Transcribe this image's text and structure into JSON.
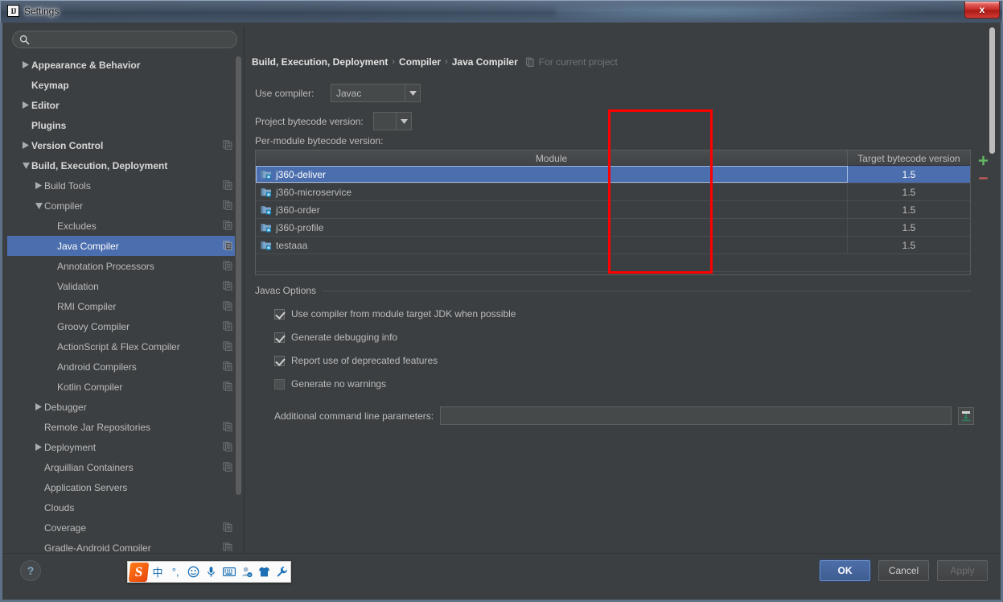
{
  "window": {
    "title": "Settings",
    "logo_text": "IJ",
    "close_label": "x"
  },
  "sidebar": {
    "search": {
      "value": "",
      "placeholder": ""
    },
    "items": [
      {
        "label": "Appearance & Behavior",
        "indent": 0,
        "arrow": "collapsed",
        "bold": true,
        "cfg": false,
        "selected": false
      },
      {
        "label": "Keymap",
        "indent": 0,
        "arrow": "none",
        "bold": true,
        "cfg": false,
        "selected": false
      },
      {
        "label": "Editor",
        "indent": 0,
        "arrow": "collapsed",
        "bold": true,
        "cfg": false,
        "selected": false
      },
      {
        "label": "Plugins",
        "indent": 0,
        "arrow": "none",
        "bold": true,
        "cfg": false,
        "selected": false
      },
      {
        "label": "Version Control",
        "indent": 0,
        "arrow": "collapsed",
        "bold": true,
        "cfg": true,
        "selected": false
      },
      {
        "label": "Build, Execution, Deployment",
        "indent": 0,
        "arrow": "expanded",
        "bold": true,
        "cfg": false,
        "selected": false
      },
      {
        "label": "Build Tools",
        "indent": 1,
        "arrow": "collapsed",
        "bold": false,
        "cfg": true,
        "selected": false
      },
      {
        "label": "Compiler",
        "indent": 1,
        "arrow": "expanded",
        "bold": false,
        "cfg": true,
        "selected": false
      },
      {
        "label": "Excludes",
        "indent": 2,
        "arrow": "none",
        "bold": false,
        "cfg": true,
        "selected": false
      },
      {
        "label": "Java Compiler",
        "indent": 2,
        "arrow": "none",
        "bold": false,
        "cfg": true,
        "selected": true
      },
      {
        "label": "Annotation Processors",
        "indent": 2,
        "arrow": "none",
        "bold": false,
        "cfg": true,
        "selected": false
      },
      {
        "label": "Validation",
        "indent": 2,
        "arrow": "none",
        "bold": false,
        "cfg": true,
        "selected": false
      },
      {
        "label": "RMI Compiler",
        "indent": 2,
        "arrow": "none",
        "bold": false,
        "cfg": true,
        "selected": false
      },
      {
        "label": "Groovy Compiler",
        "indent": 2,
        "arrow": "none",
        "bold": false,
        "cfg": true,
        "selected": false
      },
      {
        "label": "ActionScript & Flex Compiler",
        "indent": 2,
        "arrow": "none",
        "bold": false,
        "cfg": true,
        "selected": false
      },
      {
        "label": "Android Compilers",
        "indent": 2,
        "arrow": "none",
        "bold": false,
        "cfg": true,
        "selected": false
      },
      {
        "label": "Kotlin Compiler",
        "indent": 2,
        "arrow": "none",
        "bold": false,
        "cfg": true,
        "selected": false
      },
      {
        "label": "Debugger",
        "indent": 1,
        "arrow": "collapsed",
        "bold": false,
        "cfg": false,
        "selected": false
      },
      {
        "label": "Remote Jar Repositories",
        "indent": 1,
        "arrow": "none",
        "bold": false,
        "cfg": true,
        "selected": false
      },
      {
        "label": "Deployment",
        "indent": 1,
        "arrow": "collapsed",
        "bold": false,
        "cfg": true,
        "selected": false
      },
      {
        "label": "Arquillian Containers",
        "indent": 1,
        "arrow": "none",
        "bold": false,
        "cfg": true,
        "selected": false
      },
      {
        "label": "Application Servers",
        "indent": 1,
        "arrow": "none",
        "bold": false,
        "cfg": false,
        "selected": false
      },
      {
        "label": "Clouds",
        "indent": 1,
        "arrow": "none",
        "bold": false,
        "cfg": false,
        "selected": false
      },
      {
        "label": "Coverage",
        "indent": 1,
        "arrow": "none",
        "bold": false,
        "cfg": true,
        "selected": false
      },
      {
        "label": "Gradle-Android Compiler",
        "indent": 1,
        "arrow": "none",
        "bold": false,
        "cfg": true,
        "selected": false
      }
    ]
  },
  "panel": {
    "breadcrumb": {
      "seg1": "Build, Execution, Deployment",
      "sep1": "›",
      "seg2": "Compiler",
      "sep2": "›",
      "seg3": "Java Compiler",
      "note": "For current project"
    },
    "use_compiler": {
      "label": "Use compiler:",
      "value": "Javac"
    },
    "project_bytecode": {
      "label": "Project bytecode version:",
      "value": ""
    },
    "per_module_label": "Per-module bytecode version:",
    "table": {
      "columns": [
        "Module",
        "Target bytecode version"
      ],
      "rows": [
        {
          "module": "j360-deliver",
          "target": "1.5",
          "selected": true
        },
        {
          "module": "j360-microservice",
          "target": "1.5",
          "selected": false
        },
        {
          "module": "j360-order",
          "target": "1.5",
          "selected": false
        },
        {
          "module": "j360-profile",
          "target": "1.5",
          "selected": false
        },
        {
          "module": "testaaa",
          "target": "1.5",
          "selected": false
        }
      ],
      "add_label": "+",
      "remove_label": "−"
    },
    "javac_options": {
      "group_title": "Javac Options",
      "checkboxes": [
        {
          "label": "Use compiler from module target JDK when possible",
          "checked": true
        },
        {
          "label": "Generate debugging info",
          "checked": true
        },
        {
          "label": "Report use of deprecated features",
          "checked": true
        },
        {
          "label": "Generate no warnings",
          "checked": false
        }
      ],
      "additional_params": {
        "label": "Additional command line parameters:",
        "value": "",
        "placeholder": ""
      }
    }
  },
  "footer": {
    "help_label": "?",
    "ok_label": "OK",
    "cancel_label": "Cancel",
    "apply_label": "Apply"
  },
  "ime_toolbar": {
    "logo": "S",
    "items": [
      "中",
      "°,",
      "smiley-icon",
      "microphone-icon",
      "keyboard-icon",
      "user-icon",
      "skin-icon",
      "wrench-icon"
    ]
  },
  "annotation": {
    "color": "#ff0000"
  },
  "colors": {
    "accent": "#4b6eaf",
    "panel_bg": "#3c3f41",
    "text": "#bbbbbb",
    "annotation_red": "#ff0000",
    "add_green": "#5fb85f",
    "remove_red": "#c05050"
  }
}
